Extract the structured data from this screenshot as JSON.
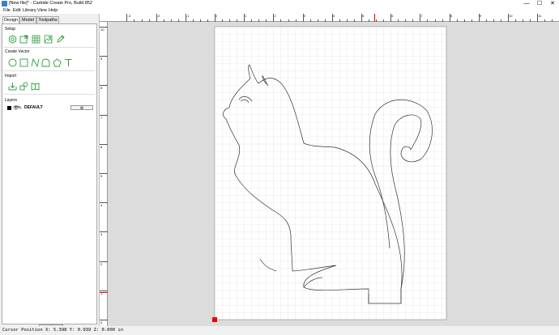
{
  "window": {
    "title": "[New file]* - Carbide Create Pro, Build 852",
    "controls": {
      "minimize": "—",
      "maximize": "☐",
      "close": "✕"
    }
  },
  "menu": [
    "File",
    "Edit",
    "Library",
    "View",
    "Help"
  ],
  "tabs": [
    "Design",
    "Model",
    "Toolpaths"
  ],
  "sections": {
    "setup": "Setup",
    "create_vector": "Create Vector",
    "import": "Import",
    "layers": "Layers"
  },
  "tools": {
    "setup": [
      "gear-icon",
      "resize-icon",
      "grid-icon",
      "image-icon",
      "pencil-icon"
    ],
    "create_vector": [
      "circle-icon",
      "rectangle-icon",
      "curve-icon",
      "polygon-icon",
      "pentagon-icon",
      "text-icon"
    ],
    "import": [
      "import-icon",
      "shapes-icon",
      "library-book-icon"
    ]
  },
  "layers": [
    {
      "name": "DEFAULT",
      "color": "#000000"
    }
  ],
  "add_layer_label": "+",
  "status": {
    "cursor": "Cursor Position X: 5.398 Y: 0.939 Z: 0.000 in"
  },
  "rulers": {
    "h_labels": [
      "-3",
      "-2",
      "-1",
      "0",
      "1",
      "2",
      "3",
      "4",
      "5",
      "6",
      "7",
      "8",
      "9",
      "10",
      "11"
    ],
    "v_labels": [
      "10",
      "9",
      "8",
      "7",
      "6",
      "5",
      "4",
      "3",
      "2",
      "1",
      "0"
    ]
  },
  "colors": {
    "accent": "#2e9e3e",
    "cursor_marker": "#e00000",
    "origin_marker": "#e00000",
    "grid": "#c8c8c8"
  }
}
